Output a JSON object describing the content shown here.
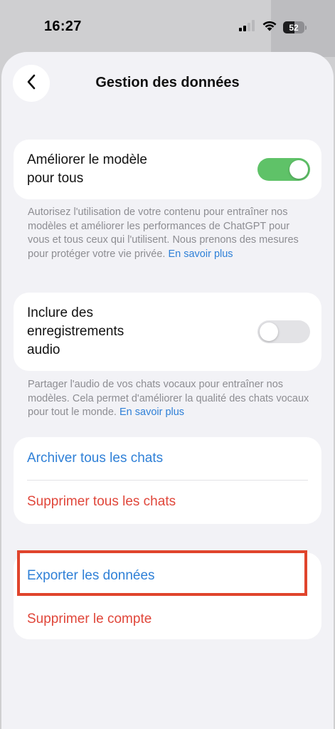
{
  "status_bar": {
    "time": "16:27",
    "battery_percent": "52",
    "battery_level": 0.52,
    "icons": [
      "signal-icon",
      "wifi-icon",
      "battery-icon"
    ]
  },
  "header": {
    "title": "Gestion des données",
    "back_icon": "chevron-left-icon"
  },
  "settings": {
    "improve_model": {
      "label_line1": "Améliorer le modèle",
      "label_line2": "pour tous",
      "enabled": true,
      "description": "Autorisez l'utilisation de votre contenu pour entraîner nos modèles et améliorer les performances de ChatGPT pour vous et tous ceux qui l'utilisent. Nous prenons des mesures pour protéger votre vie privée.",
      "link": "En savoir plus"
    },
    "audio_recordings": {
      "label_line1": "Inclure des",
      "label_line2": "enregistrements",
      "label_line3": "audio",
      "enabled": false,
      "description": "Partager l'audio de vos chats vocaux pour entraîner nos modèles. Cela permet d'améliorer la qualité des chats vocaux pour tout le monde.",
      "link": "En savoir plus"
    }
  },
  "chats_actions": {
    "archive": "Archiver tous les chats",
    "delete": "Supprimer tous les chats"
  },
  "account_actions": {
    "export": "Exporter les données",
    "delete_account": "Supprimer le compte"
  },
  "colors": {
    "accent_blue": "#2f80d7",
    "destructive_red": "#e0463a",
    "toggle_on": "#5fc268",
    "toggle_off": "#e3e3e6",
    "highlight": "#e0442c"
  }
}
